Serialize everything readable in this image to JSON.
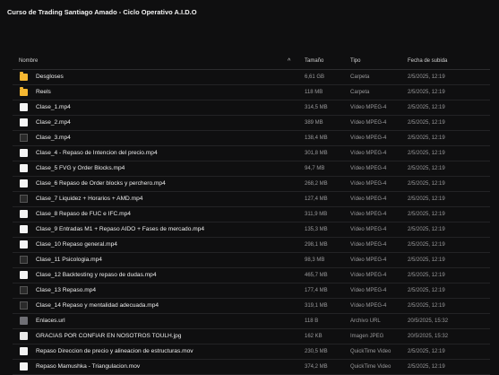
{
  "title": "Curso de Trading Santiago Amado - Ciclo Operativo A.I.D.O",
  "columns": {
    "name": "Nombre",
    "sort_icon": "^",
    "size": "Tamaño",
    "type": "Tipo",
    "date": "Fecha de subida"
  },
  "rows": [
    {
      "icon": "folder-icon",
      "name": "Desgloses",
      "size": "6,61 GB",
      "type": "Carpeta",
      "date": "2/5/2025, 12:19"
    },
    {
      "icon": "folder-icon",
      "name": "Reels",
      "size": "118 MB",
      "type": "Carpeta",
      "date": "2/5/2025, 12:19"
    },
    {
      "icon": "video-icon",
      "name": "Clase_1.mp4",
      "size": "314,5 MB",
      "type": "Vídeo MPEG-4",
      "date": "2/5/2025, 12:19"
    },
    {
      "icon": "video-icon",
      "name": "Clase_2.mp4",
      "size": "389 MB",
      "type": "Vídeo MPEG-4",
      "date": "2/5/2025, 12:19"
    },
    {
      "icon": "video-thumbnail-icon",
      "name": "Clase_3.mp4",
      "size": "138,4 MB",
      "type": "Vídeo MPEG-4",
      "date": "2/5/2025, 12:19"
    },
    {
      "icon": "video-icon",
      "name": "Clase_4 - Repaso de Intencion del precio.mp4",
      "size": "301,8 MB",
      "type": "Vídeo MPEG-4",
      "date": "2/5/2025, 12:19"
    },
    {
      "icon": "video-icon",
      "name": "Clase_5 FVG y Order Blocks.mp4",
      "size": "94,7 MB",
      "type": "Vídeo MPEG-4",
      "date": "2/5/2025, 12:19"
    },
    {
      "icon": "video-icon",
      "name": "Clase_6 Repaso de Order blocks y perchero.mp4",
      "size": "268,2 MB",
      "type": "Vídeo MPEG-4",
      "date": "2/5/2025, 12:19"
    },
    {
      "icon": "video-thumbnail-icon",
      "name": "Clase_7 Liquidez + Horarios + AMD.mp4",
      "size": "127,4 MB",
      "type": "Vídeo MPEG-4",
      "date": "2/5/2025, 12:19"
    },
    {
      "icon": "video-icon",
      "name": "Clase_8 Repaso de FUC e IFC.mp4",
      "size": "311,9 MB",
      "type": "Vídeo MPEG-4",
      "date": "2/5/2025, 12:19"
    },
    {
      "icon": "video-icon",
      "name": "Clase_9 Entradas M1 + Repaso AIDO + Fases de mercado.mp4",
      "size": "135,3 MB",
      "type": "Vídeo MPEG-4",
      "date": "2/5/2025, 12:19"
    },
    {
      "icon": "video-icon",
      "name": "Clase_10 Repaso general.mp4",
      "size": "298,1 MB",
      "type": "Vídeo MPEG-4",
      "date": "2/5/2025, 12:19"
    },
    {
      "icon": "video-thumbnail-icon",
      "name": "Clase_11 Psicologia.mp4",
      "size": "98,3 MB",
      "type": "Vídeo MPEG-4",
      "date": "2/5/2025, 12:19"
    },
    {
      "icon": "video-icon",
      "name": "Clase_12 Backtesting y repaso de dudas.mp4",
      "size": "465,7 MB",
      "type": "Vídeo MPEG-4",
      "date": "2/5/2025, 12:19"
    },
    {
      "icon": "video-thumbnail-icon",
      "name": "Clase_13 Repaso.mp4",
      "size": "177,4 MB",
      "type": "Vídeo MPEG-4",
      "date": "2/5/2025, 12:19"
    },
    {
      "icon": "video-thumbnail-icon",
      "name": "Clase_14 Repaso y mentalidad adecuada.mp4",
      "size": "319,1 MB",
      "type": "Vídeo MPEG-4",
      "date": "2/5/2025, 12:19"
    },
    {
      "icon": "link-file-icon",
      "name": "Enlaces.url",
      "size": "118 B",
      "type": "Archivo URL",
      "date": "20/5/2025, 15:32"
    },
    {
      "icon": "image-file-icon",
      "name": "GRACIAS POR CONFIAR EN NOSOTROS TOULH.jpg",
      "size": "162 KB",
      "type": "Imagen JPEG",
      "date": "20/5/2025, 15:32"
    },
    {
      "icon": "video-icon",
      "name": "Repaso Direccion de precio y alineacion de estructuras.mov",
      "size": "230,5 MB",
      "type": "QuickTime Video",
      "date": "2/5/2025, 12:19"
    },
    {
      "icon": "video-icon",
      "name": "Repaso Mamushka - Triangulacion.mov",
      "size": "374,2 MB",
      "type": "QuickTime Video",
      "date": "2/5/2025, 12:19"
    }
  ]
}
